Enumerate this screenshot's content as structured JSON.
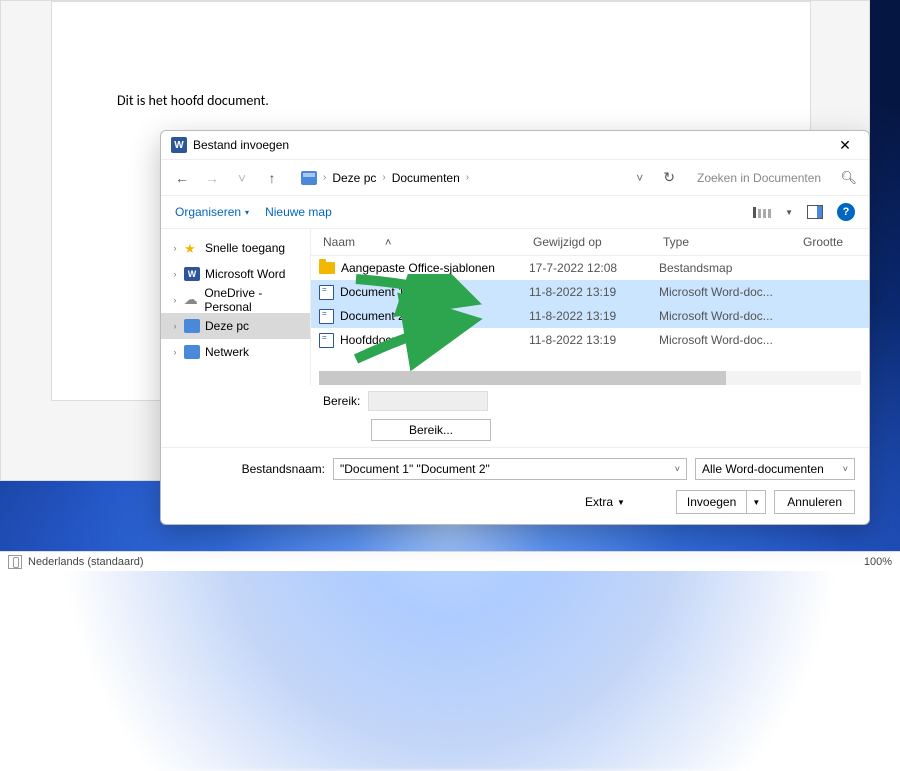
{
  "word": {
    "page_text": "Dit is het hoofd document.",
    "status_language": "Nederlands (standaard)",
    "status_zoom": "100%"
  },
  "dialog": {
    "title": "Bestand invoegen",
    "breadcrumb": {
      "root": "Deze pc",
      "folder": "Documenten"
    },
    "search_placeholder": "Zoeken in Documenten",
    "toolbar": {
      "organize": "Organiseren",
      "new_folder": "Nieuwe map"
    },
    "columns": {
      "name": "Naam",
      "modified": "Gewijzigd op",
      "type": "Type",
      "size": "Grootte"
    },
    "tree": {
      "quick": "Snelle toegang",
      "word": "Microsoft Word",
      "onedrive": "OneDrive - Personal",
      "thispc": "Deze pc",
      "network": "Netwerk"
    },
    "files": [
      {
        "name": "Aangepaste Office-sjablonen",
        "modified": "17-7-2022 12:08",
        "type": "Bestandsmap",
        "kind": "folder",
        "sel": false
      },
      {
        "name": "Document 1",
        "modified": "11-8-2022 13:19",
        "type": "Microsoft Word-doc...",
        "kind": "doc",
        "sel": true
      },
      {
        "name": "Document 2",
        "modified": "11-8-2022 13:19",
        "type": "Microsoft Word-doc...",
        "kind": "doc",
        "sel": true
      },
      {
        "name": "Hoofddocument",
        "modified": "11-8-2022 13:19",
        "type": "Microsoft Word-doc...",
        "kind": "doc",
        "sel": false
      }
    ],
    "bereik_label": "Bereik:",
    "bereik_button": "Bereik...",
    "filename_label": "Bestandsnaam:",
    "filename_value": "\"Document 1\" \"Document 2\"",
    "filetype": "Alle Word-documenten",
    "extra": "Extra",
    "insert": "Invoegen",
    "cancel": "Annuleren"
  }
}
